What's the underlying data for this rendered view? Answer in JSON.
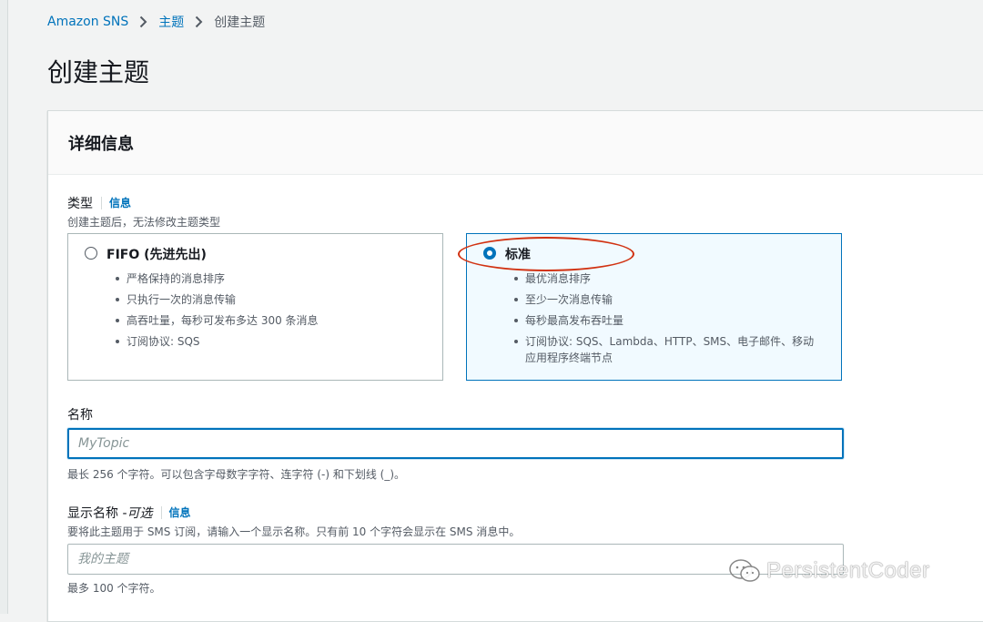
{
  "breadcrumb": {
    "items": [
      "Amazon SNS",
      "主题"
    ],
    "current": "创建主题"
  },
  "page": {
    "title": "创建主题"
  },
  "details": {
    "title": "详细信息",
    "type": {
      "label": "类型",
      "info": "信息",
      "description": "创建主题后，无法修改主题类型",
      "options": [
        {
          "title": "FIFO (先进先出)",
          "selected": false,
          "bullets": [
            "严格保持的消息排序",
            "只执行一次的消息传输",
            "高吞吐量，每秒可发布多达 300 条消息",
            "订阅协议: SQS"
          ]
        },
        {
          "title": "标准",
          "selected": true,
          "bullets": [
            "最优消息排序",
            "至少一次消息传输",
            "每秒最高发布吞吐量",
            "订阅协议: SQS、Lambda、HTTP、SMS、电子邮件、移动应用程序终端节点"
          ]
        }
      ]
    },
    "name": {
      "label": "名称",
      "placeholder": "MyTopic",
      "value": "",
      "hint": "最长 256 个字符。可以包含字母数字字符、连字符 (-) 和下划线 (_)。"
    },
    "display_name": {
      "label": "显示名称 - ",
      "optional": "可选",
      "info": "信息",
      "description": "要将此主题用于 SMS 订阅，请输入一个显示名称。只有前 10 个字符会显示在 SMS 消息中。",
      "placeholder": "我的主题",
      "value": "",
      "hint": "最多 100 个字符。"
    }
  },
  "watermark": {
    "text": "PersistentCoder"
  },
  "colors": {
    "link": "#0073bb",
    "selected_border": "#0073bb",
    "selected_bg": "#f1faff",
    "annotation": "#d13212"
  }
}
